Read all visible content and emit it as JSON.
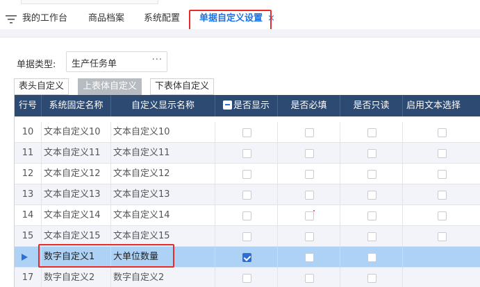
{
  "tabs": [
    {
      "label": "我的工作台"
    },
    {
      "label": "商品档案"
    },
    {
      "label": "系统配置"
    },
    {
      "label": "单据自定义设置",
      "active": true,
      "close": "×"
    }
  ],
  "form": {
    "doc_type_label": "单据类型:",
    "doc_type_value": "生产任务单",
    "more_glyph": "···"
  },
  "subtabs": [
    {
      "label": "表头自定义",
      "active": false
    },
    {
      "label": "上表体自定义",
      "active": true
    },
    {
      "label": "下表体自定义",
      "active": false
    }
  ],
  "table": {
    "columns": [
      "行号",
      "系统固定名称",
      "自定义显示名称",
      "是否显示",
      "是否必填",
      "是否只读",
      "启用文本选择"
    ],
    "rows": [
      {
        "no": "10",
        "sys": "文本自定义10",
        "custom": "文本自定义10",
        "show": false,
        "required": false,
        "readonly": false,
        "textsel": false
      },
      {
        "no": "11",
        "sys": "文本自定义11",
        "custom": "文本自定义11",
        "show": false,
        "required": false,
        "readonly": false,
        "textsel": false
      },
      {
        "no": "12",
        "sys": "文本自定义12",
        "custom": "文本自定义12",
        "show": false,
        "required": false,
        "readonly": false,
        "textsel": false
      },
      {
        "no": "13",
        "sys": "文本自定义13",
        "custom": "文本自定义13",
        "show": false,
        "required": false,
        "readonly": false,
        "textsel": false
      },
      {
        "no": "14",
        "sys": "文本自定义14",
        "custom": "文本自定义14",
        "show": false,
        "required": false,
        "readonly": false,
        "textsel": false
      },
      {
        "no": "15",
        "sys": "文本自定义15",
        "custom": "文本自定义15",
        "show": false,
        "required": false,
        "readonly": false,
        "textsel": false
      },
      {
        "no": "",
        "sys": "数字自定义1",
        "custom": "大单位数量",
        "show": true,
        "required": false,
        "readonly": false,
        "textsel": null,
        "selected": true
      },
      {
        "no": "17",
        "sys": "数字自定义2",
        "custom": "数字自定义2",
        "show": false,
        "required": false,
        "readonly": false,
        "textsel": null
      }
    ]
  },
  "colors": {
    "accent": "#1a73e8",
    "header_bg": "#2d4a73",
    "selected_row": "#add2f5",
    "highlight_box": "#e82a2a"
  }
}
